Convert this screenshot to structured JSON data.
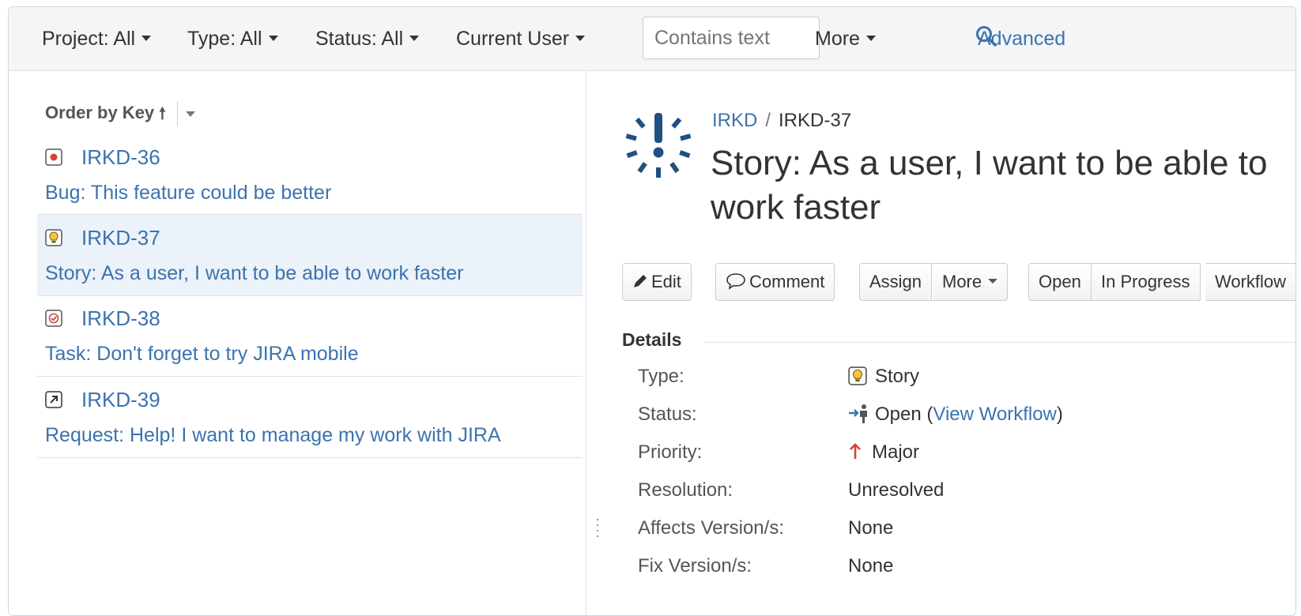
{
  "filters": {
    "project": "Project: All",
    "type": "Type: All",
    "status": "Status: All",
    "user": "Current User",
    "text_placeholder": "Contains text",
    "more": "More",
    "advanced": "Advanced"
  },
  "list": {
    "order_label": "Order by Key",
    "issues": [
      {
        "key": "IRKD-36",
        "summary": "Bug: This feature could be better",
        "type_icon": "bug-icon",
        "selected": false
      },
      {
        "key": "IRKD-37",
        "summary": "Story: As a user, I want to be able to work faster",
        "type_icon": "story-icon",
        "selected": true
      },
      {
        "key": "IRKD-38",
        "summary": "Task: Don't forget to try JIRA mobile",
        "type_icon": "task-icon",
        "selected": false
      },
      {
        "key": "IRKD-39",
        "summary": "Request: Help! I want to manage my work with JIRA",
        "type_icon": "request-icon",
        "selected": false
      }
    ]
  },
  "detail": {
    "breadcrumb_project": "IRKD",
    "breadcrumb_sep": "/",
    "breadcrumb_key": "IRKD-37",
    "title": "Story: As a user, I want to be able to work faster",
    "buttons": {
      "edit": "Edit",
      "comment": "Comment",
      "assign": "Assign",
      "more": "More",
      "open": "Open",
      "in_progress": "In Progress",
      "workflow": "Workflow"
    },
    "details_heading": "Details",
    "fields": {
      "type_label": "Type:",
      "type_value": "Story",
      "status_label": "Status:",
      "status_value": "Open",
      "status_open_paren": " (",
      "status_link": "View Workflow",
      "status_close_paren": ")",
      "priority_label": "Priority:",
      "priority_value": "Major",
      "resolution_label": "Resolution:",
      "resolution_value": "Unresolved",
      "affects_label": "Affects Version/s:",
      "affects_value": "None",
      "fix_label": "Fix Version/s:",
      "fix_value": "None"
    }
  },
  "colors": {
    "link": "#3b73af",
    "selected_row": "#ebf2f9",
    "bug": "#d04437",
    "story": "#f6c342",
    "priority_major": "#d04437",
    "logo": "#205081"
  }
}
